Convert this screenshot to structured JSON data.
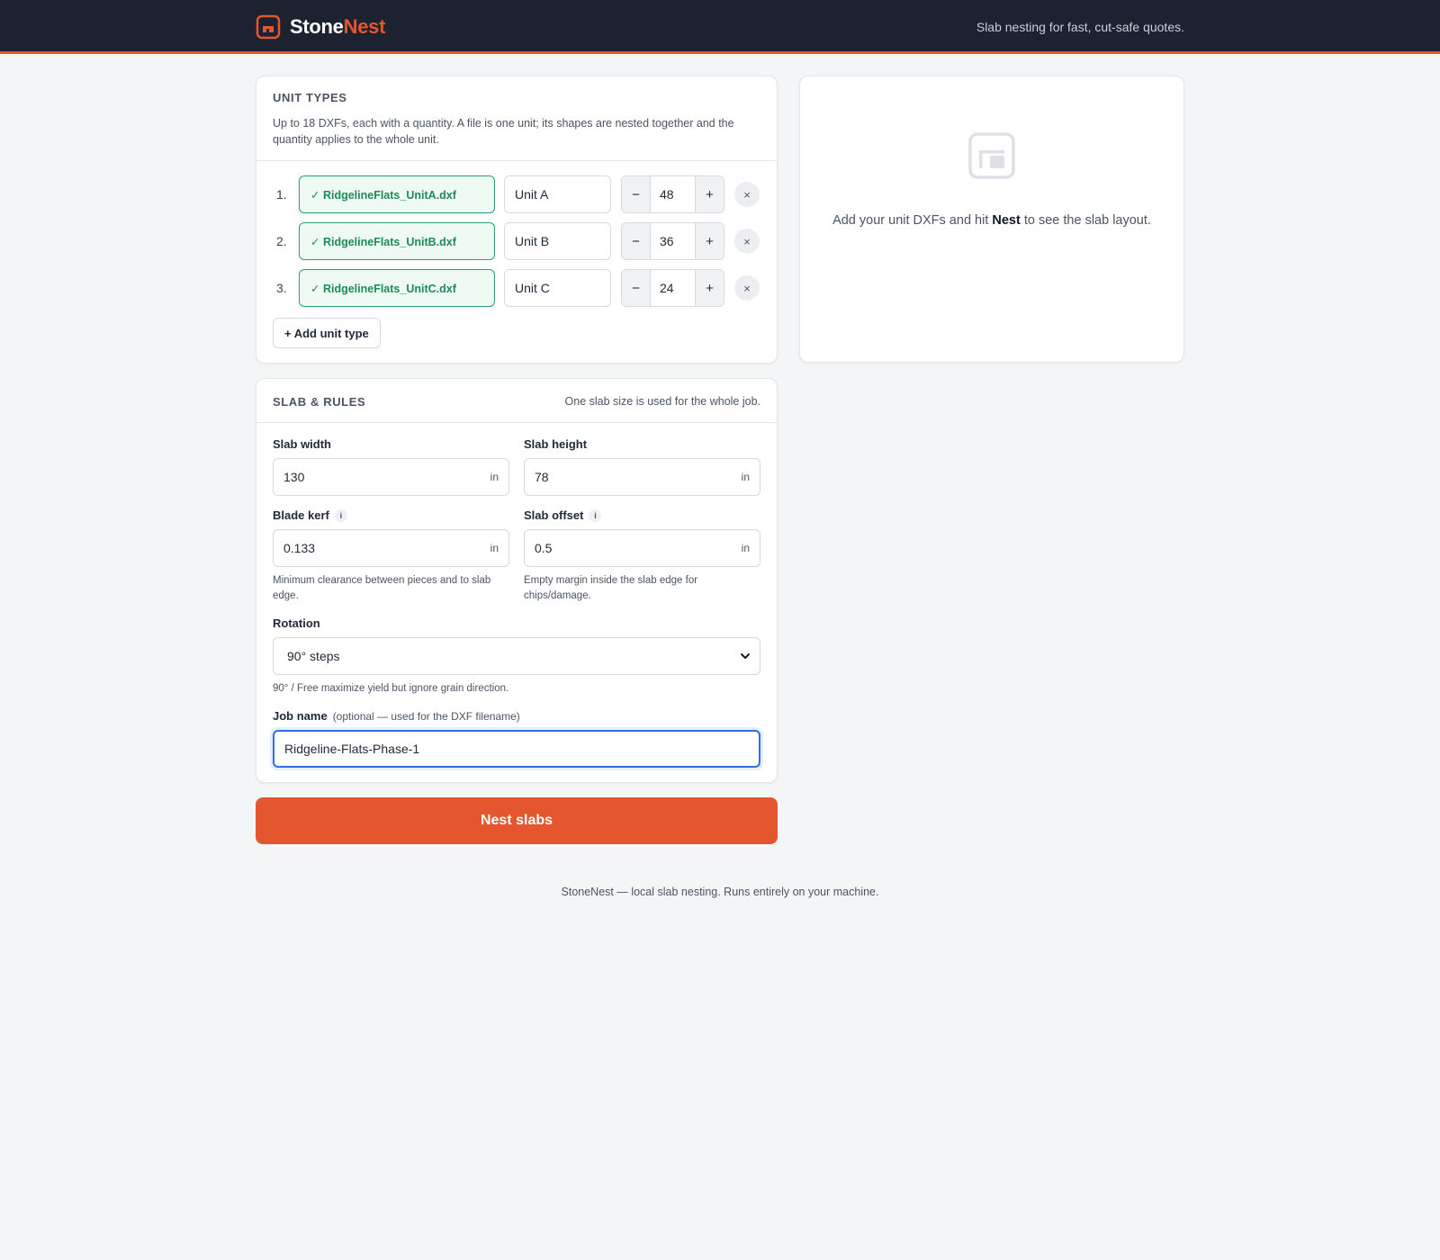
{
  "app": {
    "brand_main": "Stone",
    "brand_accent": "Nest",
    "tagline": "Slab nesting for fast, cut-safe quotes.",
    "accent_color": "#e4572e"
  },
  "unit_types": {
    "title": "UNIT TYPES",
    "description": "Up to 18 DXFs, each with a quantity. A file is one unit; its shapes are nested together and the quantity applies to the whole unit.",
    "rows": [
      {
        "num": "1.",
        "file": "✓ RidgelineFlats_UnitA.dxf",
        "name": "Unit A",
        "qty": "48"
      },
      {
        "num": "2.",
        "file": "✓ RidgelineFlats_UnitB.dxf",
        "name": "Unit B",
        "qty": "36"
      },
      {
        "num": "3.",
        "file": "✓ RidgelineFlats_UnitC.dxf",
        "name": "Unit C",
        "qty": "24"
      }
    ],
    "minus": "−",
    "plus": "+",
    "remove": "×",
    "add_label": "+ Add unit type"
  },
  "slab_rules": {
    "title": "SLAB & RULES",
    "note": "One slab size is used for the whole job.",
    "slab_width": {
      "label": "Slab width",
      "value": "130",
      "unit": "in"
    },
    "slab_height": {
      "label": "Slab height",
      "value": "78",
      "unit": "in"
    },
    "blade_kerf": {
      "label": "Blade kerf",
      "value": "0.133",
      "unit": "in",
      "help": "Minimum clearance between pieces and to slab edge."
    },
    "slab_offset": {
      "label": "Slab offset",
      "value": "0.5",
      "unit": "in",
      "help": "Empty margin inside the slab edge for chips/damage."
    },
    "rotation": {
      "label": "Rotation",
      "value": "90° steps",
      "help": "90° / Free maximize yield but ignore grain direction."
    },
    "job_name": {
      "label": "Job name",
      "optional": "(optional — used for the DXF filename)",
      "value": "Ridgeline-Flats-Phase-1"
    },
    "info_glyph": "i"
  },
  "actions": {
    "nest_label": "Nest slabs"
  },
  "preview": {
    "msg_before": "Add your unit DXFs and hit ",
    "msg_bold": "Nest",
    "msg_after": " to see the slab layout."
  },
  "footer": "StoneNest — local slab nesting. Runs entirely on your machine."
}
